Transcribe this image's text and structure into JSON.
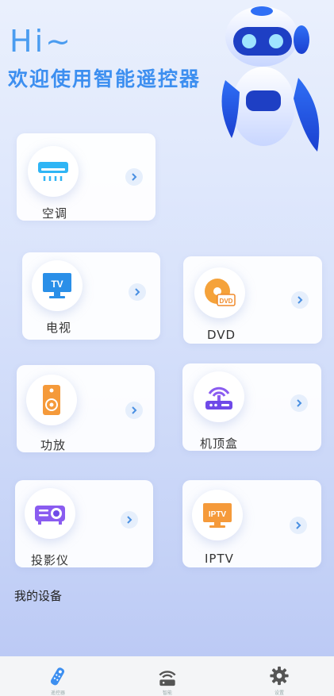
{
  "header": {
    "greeting": "Hi~",
    "welcome": "欢迎使用智能遥控器"
  },
  "devices": {
    "ac": {
      "label": "空调",
      "icon": "air-conditioner-icon"
    },
    "tv": {
      "label": "电视",
      "icon": "tv-icon",
      "icon_text": "TV"
    },
    "dvd": {
      "label": "DVD",
      "icon": "dvd-icon",
      "icon_text": "DVD"
    },
    "amp": {
      "label": "功放",
      "icon": "speaker-icon"
    },
    "stb": {
      "label": "机顶盒",
      "icon": "router-icon"
    },
    "projector": {
      "label": "投影仪",
      "icon": "projector-icon"
    },
    "iptv": {
      "label": "IPTV",
      "icon": "iptv-icon",
      "icon_text": "IPTV"
    }
  },
  "section_title": "我的设备",
  "tabs": [
    {
      "icon": "remote-control-icon",
      "label": "遥控器",
      "active": true
    },
    {
      "icon": "network-icon",
      "label": "智能",
      "active": false
    },
    {
      "icon": "gear-icon",
      "label": "设置",
      "active": false
    }
  ],
  "colors": {
    "accent": "#3d8ff0",
    "chevron": "#4a90e2"
  }
}
